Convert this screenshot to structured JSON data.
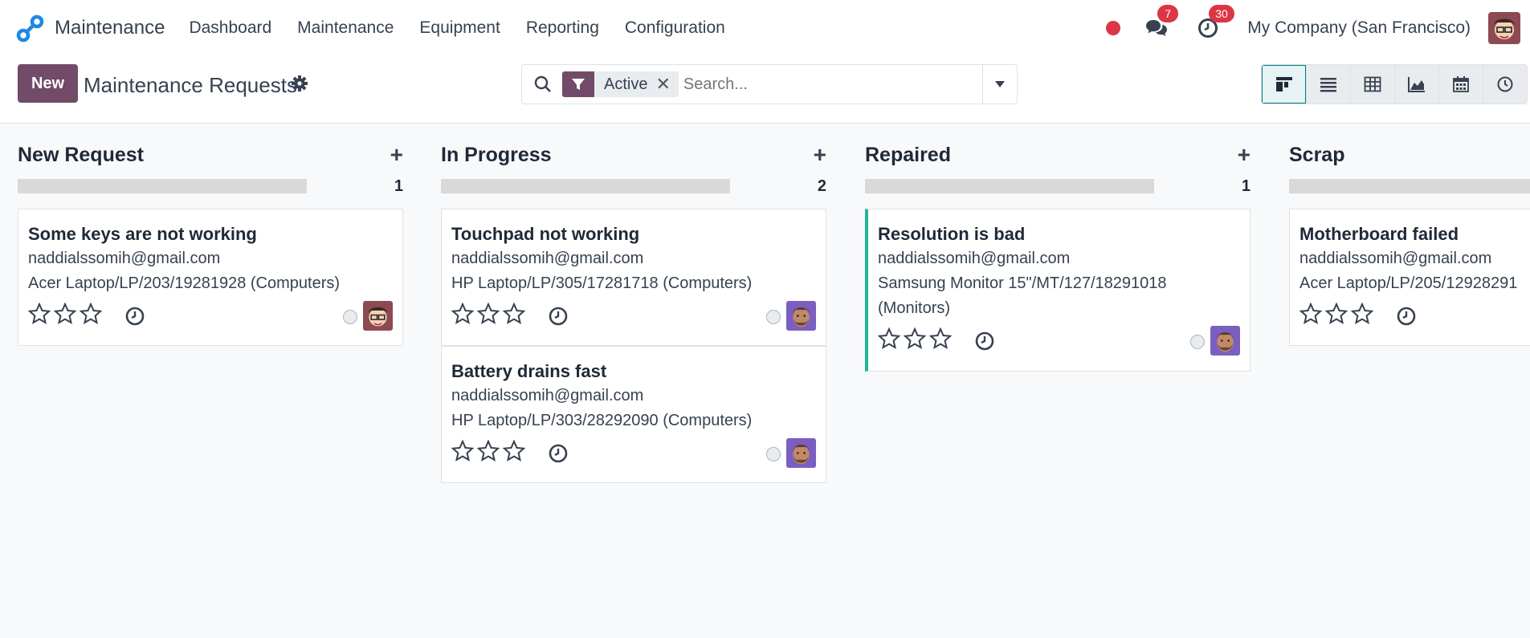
{
  "navbar": {
    "app_name": "Maintenance",
    "menu": [
      "Dashboard",
      "Maintenance",
      "Equipment",
      "Reporting",
      "Configuration"
    ],
    "messages_count": "7",
    "activities_count": "30",
    "company": "My Company (San Francisco)"
  },
  "control": {
    "new_label": "New",
    "title": "Maintenance Requests",
    "facet_label": "Active",
    "search_placeholder": "Search..."
  },
  "colors": {
    "brand": "#714b67",
    "accent_teal": "#017e84",
    "badge_red": "#dc3545",
    "card_accent": "#21b799"
  },
  "columns": [
    {
      "title": "New Request",
      "count": "1",
      "cards": [
        {
          "title": "Some keys are not working",
          "email": "naddialssomih@gmail.com",
          "equipment": "Acer Laptop/LP/203/19281928 (Computers)",
          "stars": 0,
          "avatar": "user-avatar"
        }
      ]
    },
    {
      "title": "In Progress",
      "count": "2",
      "cards": [
        {
          "title": "Touchpad not working",
          "email": "naddialssomih@gmail.com",
          "equipment": "HP Laptop/LP/305/17281718 (Computers)",
          "stars": 0,
          "avatar": "technician-avatar"
        },
        {
          "title": "Battery drains fast",
          "email": "naddialssomih@gmail.com",
          "equipment": "HP Laptop/LP/303/28292090 (Computers)",
          "stars": 0,
          "avatar": "technician-avatar"
        }
      ]
    },
    {
      "title": "Repaired",
      "count": "1",
      "cards": [
        {
          "title": "Resolution is bad",
          "email": "naddialssomih@gmail.com",
          "equipment": "Samsung Monitor 15\"/MT/127/18291018",
          "equipment_line2": "(Monitors)",
          "stars": 0,
          "avatar": "technician-avatar"
        }
      ]
    },
    {
      "title": "Scrap",
      "cards": [
        {
          "title": "Motherboard failed",
          "email": "naddialssomih@gmail.com",
          "equipment": "Acer Laptop/LP/205/12928291",
          "stars": 0
        }
      ]
    }
  ]
}
